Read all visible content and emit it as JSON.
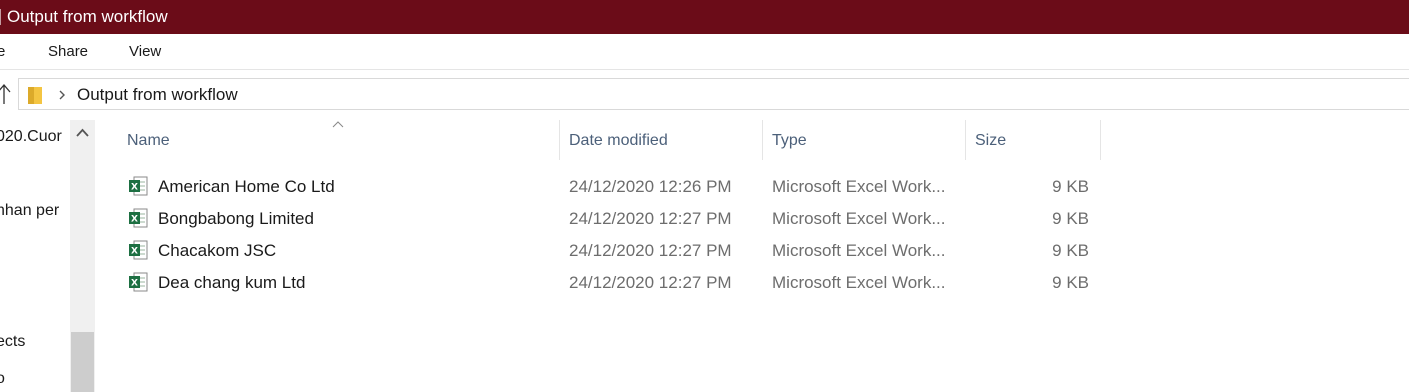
{
  "window": {
    "title": "Output from workflow",
    "titlebar_color": "#6b0c18"
  },
  "ribbon": {
    "tabs": [
      {
        "label": "e"
      },
      {
        "label": "Share"
      },
      {
        "label": "View"
      }
    ]
  },
  "address": {
    "path_segment": "Output from workflow"
  },
  "nav": {
    "items": [
      {
        "label": "020.Cuor"
      },
      {
        "label": "nhan per"
      },
      {
        "label": "ects"
      },
      {
        "label": "o"
      }
    ]
  },
  "columns": {
    "name": "Name",
    "date": "Date modified",
    "type": "Type",
    "size": "Size"
  },
  "files": [
    {
      "name": "American Home Co Ltd",
      "date": "24/12/2020 12:26 PM",
      "type": "Microsoft Excel Work...",
      "size": "9 KB",
      "icon": "excel-file-icon"
    },
    {
      "name": "Bongbabong Limited",
      "date": "24/12/2020 12:27 PM",
      "type": "Microsoft Excel Work...",
      "size": "9 KB",
      "icon": "excel-file-icon"
    },
    {
      "name": "Chacakom JSC",
      "date": "24/12/2020 12:27 PM",
      "type": "Microsoft Excel Work...",
      "size": "9 KB",
      "icon": "excel-file-icon"
    },
    {
      "name": "Dea chang kum Ltd",
      "date": "24/12/2020 12:27 PM",
      "type": "Microsoft Excel Work...",
      "size": "9 KB",
      "icon": "excel-file-icon"
    }
  ],
  "colors": {
    "excel_green": "#1d6f42",
    "header_text": "#4c607a",
    "folder_yellow": "#f4c542"
  }
}
